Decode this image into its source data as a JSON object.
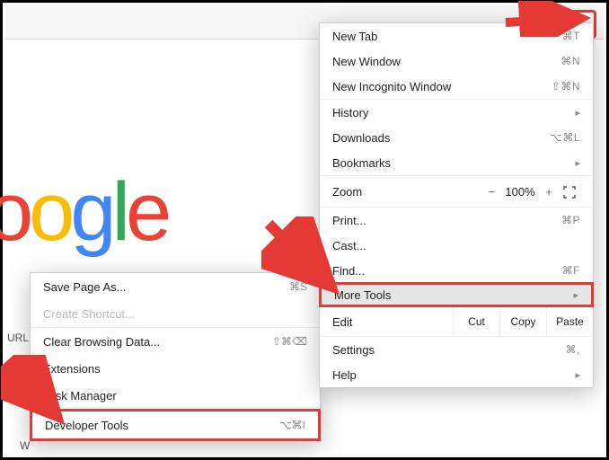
{
  "logo_letters": [
    "o",
    "o",
    "g",
    "l",
    "e"
  ],
  "sidelabels": {
    "url": "URL",
    "w": "W"
  },
  "menu": {
    "new_tab": {
      "label": "New Tab",
      "shortcut": "⌘T"
    },
    "new_window": {
      "label": "New Window",
      "shortcut": "⌘N"
    },
    "new_incognito": {
      "label": "New Incognito Window",
      "shortcut": "⇧⌘N"
    },
    "history": {
      "label": "History"
    },
    "downloads": {
      "label": "Downloads",
      "shortcut": "⌥⌘L"
    },
    "bookmarks": {
      "label": "Bookmarks"
    },
    "zoom": {
      "label": "Zoom",
      "minus": "−",
      "plus": "+",
      "value": "100%"
    },
    "print": {
      "label": "Print...",
      "shortcut": "⌘P"
    },
    "cast": {
      "label": "Cast..."
    },
    "find": {
      "label": "Find...",
      "shortcut": "⌘F"
    },
    "more_tools": {
      "label": "More Tools"
    },
    "edit": {
      "label": "Edit",
      "cut": "Cut",
      "copy": "Copy",
      "paste": "Paste"
    },
    "settings": {
      "label": "Settings",
      "shortcut": "⌘,"
    },
    "help": {
      "label": "Help"
    }
  },
  "submenu": {
    "save_page": {
      "label": "Save Page As...",
      "shortcut": "⌘S"
    },
    "create_shortcut": {
      "label": "Create Shortcut..."
    },
    "clear_browsing": {
      "label": "Clear Browsing Data...",
      "shortcut": "⇧⌘⌫"
    },
    "extensions": {
      "label": "Extensions"
    },
    "task_manager": {
      "label": "Task Manager"
    },
    "developer_tools": {
      "label": "Developer Tools",
      "shortcut": "⌥⌘I"
    }
  }
}
